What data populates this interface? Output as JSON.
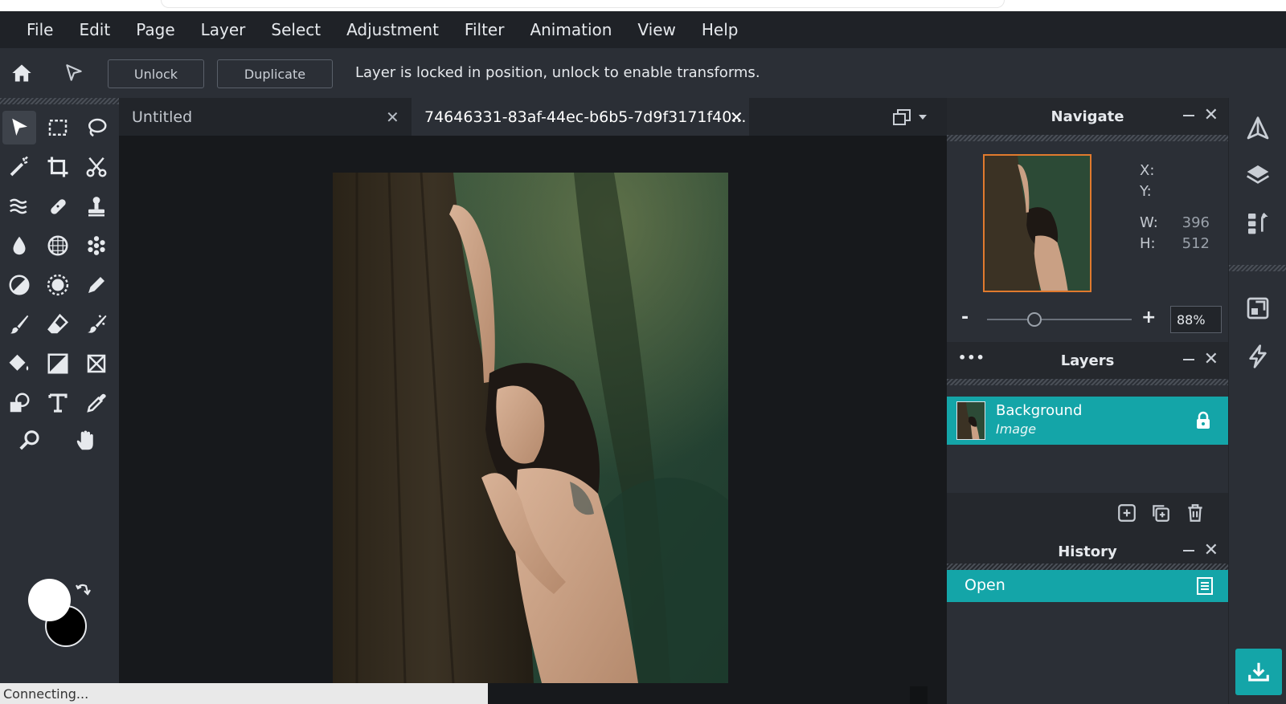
{
  "menu": [
    "File",
    "Edit",
    "Page",
    "Layer",
    "Select",
    "Adjustment",
    "Filter",
    "Animation",
    "View",
    "Help"
  ],
  "options": {
    "unlock_label": "Unlock",
    "duplicate_label": "Duplicate",
    "message": "Layer is locked in position, unlock to enable transforms."
  },
  "tabs": [
    {
      "title": "Untitled"
    },
    {
      "title": "74646331-83af-44ec-b6b5-7d9f3171f40..."
    }
  ],
  "colors": {
    "foreground": "#ffffff",
    "background": "#000000",
    "accent": "#14a5a8"
  },
  "navigate": {
    "title": "Navigate",
    "x_label": "X:",
    "y_label": "Y:",
    "w_label": "W:",
    "h_label": "H:",
    "w_value": "396",
    "h_value": "512",
    "zoom_minus": "-",
    "zoom_plus": "+",
    "zoom_value": "88%"
  },
  "layers": {
    "title": "Layers",
    "more": "•••",
    "items": [
      {
        "name": "Background",
        "type": "Image",
        "locked": true
      }
    ]
  },
  "history": {
    "title": "History",
    "items": [
      {
        "label": "Open"
      }
    ]
  },
  "status": {
    "text": "Connecting..."
  }
}
